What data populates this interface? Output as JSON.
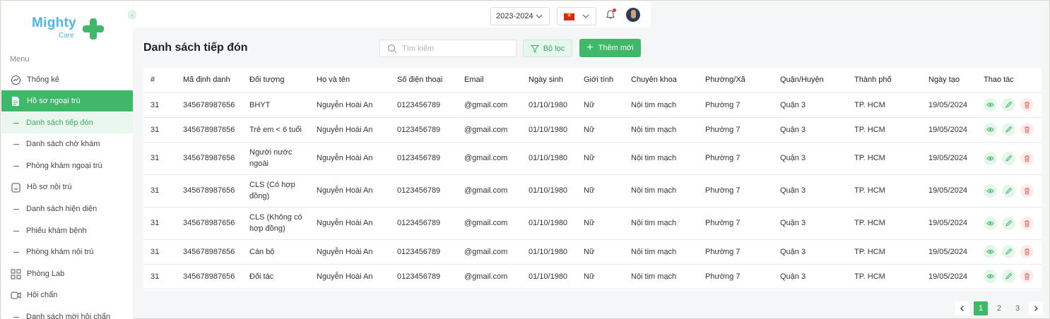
{
  "brand": {
    "name_top": "Mighty",
    "name_bottom": "Care"
  },
  "sidebar": {
    "menu_label": "Menu",
    "items": [
      {
        "label": "Thống kê",
        "icon": "chart-gauge-icon",
        "type": "main"
      },
      {
        "label": "Hồ sơ ngoại trú",
        "icon": "document-icon",
        "type": "main-active"
      },
      {
        "label": "Danh sách tiếp đón",
        "type": "sub-active"
      },
      {
        "label": "Danh sách chờ khám",
        "type": "sub"
      },
      {
        "label": "Phòng khám ngoại trú",
        "type": "sub"
      },
      {
        "label": "Hồ sơ nội trú",
        "icon": "clipboard-icon",
        "type": "main"
      },
      {
        "label": "Danh sách hiện diện",
        "type": "sub"
      },
      {
        "label": "Phiếu khám bệnh",
        "type": "sub"
      },
      {
        "label": "Phòng khám nội trú",
        "type": "sub"
      },
      {
        "label": "Phòng Lab",
        "icon": "grid-icon",
        "type": "main"
      },
      {
        "label": "Hội chẩn",
        "icon": "video-icon",
        "type": "main"
      },
      {
        "label": "Danh sách mời hội chẩn",
        "type": "sub"
      }
    ]
  },
  "header": {
    "year": "2023-2024",
    "language_flag": "vietnam-flag-icon"
  },
  "page": {
    "title": "Danh sách tiếp đón",
    "search_placeholder": "Tìm kiếm",
    "filter_label": "Bộ lọc",
    "add_label": "Thêm mới"
  },
  "table": {
    "columns": [
      "#",
      "Mã định danh",
      "Đối tượng",
      "Họ và tên",
      "Số điện thoại",
      "Email",
      "Ngày sinh",
      "Giới tính",
      "Chuyên khoa",
      "Phường/Xã",
      "Quận/Huyện",
      "Thành phố",
      "Ngày tạo",
      "Thao tác"
    ],
    "rows": [
      [
        "31",
        "345678987656",
        "BHYT",
        "Nguyễn Hoài An",
        "0123456789",
        "@gmail.com",
        "01/10/1980",
        "Nữ",
        "Nội tim mạch",
        "Phường 7",
        "Quận 3",
        "TP. HCM",
        "19/05/2024"
      ],
      [
        "31",
        "345678987656",
        "Trẻ em < 6 tuổi",
        "Nguyễn Hoài An",
        "0123456789",
        "@gmail.com",
        "01/10/1980",
        "Nữ",
        "Nội tim mạch",
        "Phường 7",
        "Quận 3",
        "TP. HCM",
        "19/05/2024"
      ],
      [
        "31",
        "345678987656",
        "Người nước ngoài",
        "Nguyễn Hoài An",
        "0123456789",
        "@gmail.com",
        "01/10/1980",
        "Nữ",
        "Nội tim mạch",
        "Phường 7",
        "Quận 3",
        "TP. HCM",
        "19/05/2024"
      ],
      [
        "31",
        "345678987656",
        "CLS (Có hợp đồng)",
        "Nguyễn Hoài An",
        "0123456789",
        "@gmail.com",
        "01/10/1980",
        "Nữ",
        "Nội tim mạch",
        "Phường 7",
        "Quận 3",
        "TP. HCM",
        "19/05/2024"
      ],
      [
        "31",
        "345678987656",
        "CLS (Không có hợp đồng)",
        "Nguyễn Hoài An",
        "0123456789",
        "@gmail.com",
        "01/10/1980",
        "Nữ",
        "Nội tim mạch",
        "Phường 7",
        "Quận 3",
        "TP. HCM",
        "19/05/2024"
      ],
      [
        "31",
        "345678987656",
        "Cán bộ",
        "Nguyễn Hoài An",
        "0123456789",
        "@gmail.com",
        "01/10/1980",
        "Nữ",
        "Nội tim mạch",
        "Phường 7",
        "Quận 3",
        "TP. HCM",
        "19/05/2024"
      ],
      [
        "31",
        "345678987656",
        "Đối tác",
        "Nguyễn Hoài An",
        "0123456789",
        "@gmail.com",
        "01/10/1980",
        "Nữ",
        "Nội tim mạch",
        "Phường 7",
        "Quận 3",
        "TP. HCM",
        "19/05/2024"
      ]
    ]
  },
  "pagination": {
    "pages": [
      "1",
      "2",
      "3"
    ],
    "current": "1"
  },
  "colors": {
    "primary": "#3fb86a",
    "brand_blue": "#4cb5e8",
    "danger": "#e57373"
  }
}
